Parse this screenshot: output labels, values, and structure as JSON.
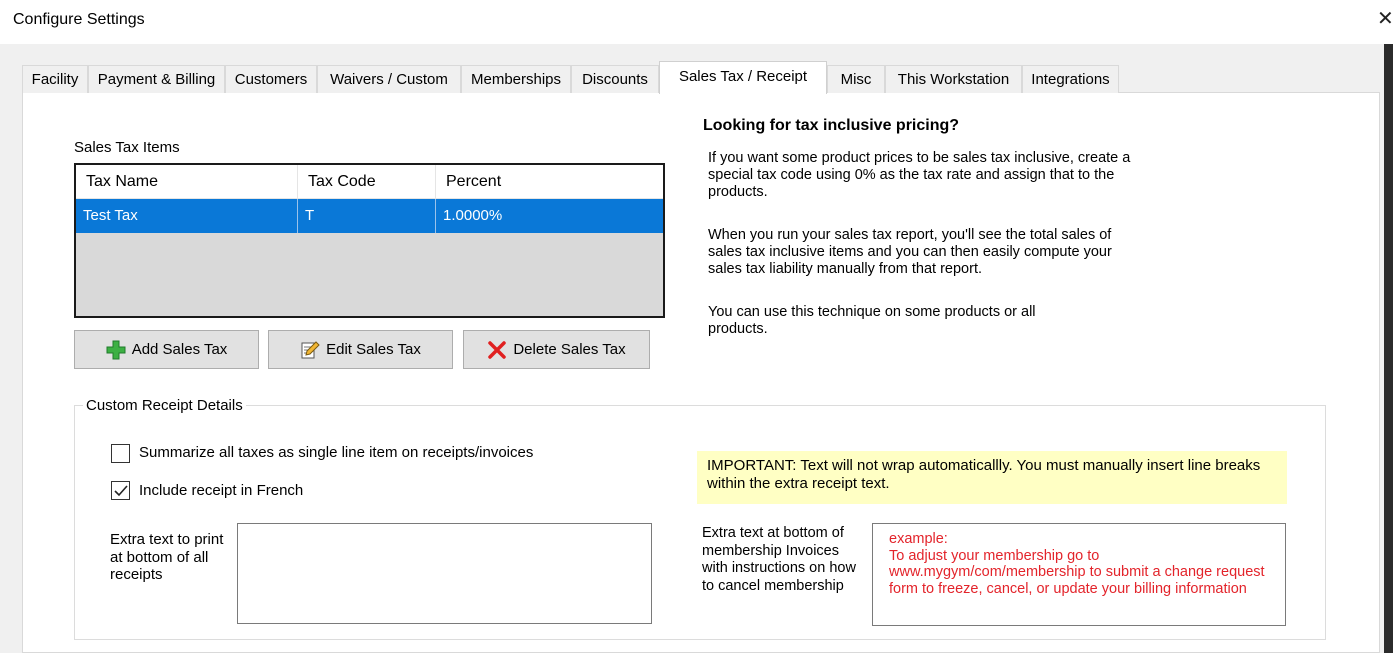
{
  "window": {
    "title": "Configure Settings",
    "close_glyph": "✕"
  },
  "tabs": [
    {
      "label": "Facility"
    },
    {
      "label": "Payment & Billing"
    },
    {
      "label": "Customers"
    },
    {
      "label": "Waivers / Custom"
    },
    {
      "label": "Memberships"
    },
    {
      "label": "Discounts"
    },
    {
      "label": "Sales Tax / Receipt",
      "active": true
    },
    {
      "label": "Misc"
    },
    {
      "label": "This Workstation"
    },
    {
      "label": "Integrations"
    }
  ],
  "sales_tax": {
    "section_label": "Sales Tax Items",
    "columns": [
      "Tax Name",
      "Tax Code",
      "Percent"
    ],
    "rows": [
      {
        "name": "Test Tax",
        "code": "T",
        "percent": "1.0000%",
        "selected": true
      }
    ],
    "buttons": {
      "add": "Add Sales Tax",
      "edit": "Edit Sales Tax",
      "delete": "Delete Sales Tax"
    }
  },
  "info": {
    "title": "Looking for tax inclusive pricing?",
    "para1": "If you want some product prices to be sales tax inclusive, create a special tax code using 0% as the tax rate and assign that to the products.",
    "para2": "When you run your sales tax report, you'll see the total sales of sales tax inclusive items and you can then easily compute your sales tax liability manually from that report.",
    "para3": "You can use this technique on some products or all products."
  },
  "receipt": {
    "group_label": "Custom Receipt Details",
    "summarize_label": "Summarize all taxes as single line item on receipts/invoices",
    "summarize_checked": false,
    "french_label": "Include receipt in French",
    "french_checked": true,
    "important_note": "IMPORTANT:  Text will not wrap automaticallly.  You must manually insert line breaks within the extra receipt text.",
    "extra_text_label": "Extra text to print at bottom of all receipts",
    "extra_text_value": "",
    "membership_label": "Extra text at bottom of membership Invoices with instructions on how to cancel membership",
    "membership_example": "example:\nTo adjust your membership go to www.mygym/com/membership to submit a change request form to freeze, cancel, or update your billing information"
  },
  "colors": {
    "selection": "#0a78d7",
    "note_bg": "#ffffc4",
    "example_text": "#e3242b",
    "delete_icon": "#e02020",
    "add_icon": "#3cb043"
  }
}
